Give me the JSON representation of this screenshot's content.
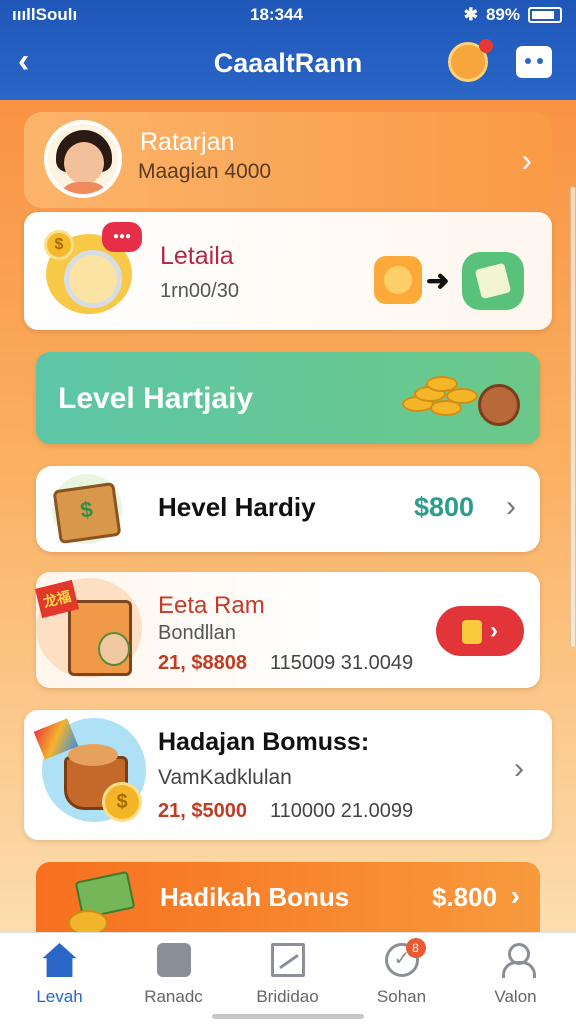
{
  "status": {
    "carrier": "ıııllSoulı",
    "time": "18:344",
    "battery": "89%"
  },
  "header": {
    "title": "CaaaltRann"
  },
  "profile": {
    "name": "Ratarjan",
    "subtitle": "Maagian 4000"
  },
  "card1": {
    "title": "Letaila",
    "subtitle": "1rn00/30"
  },
  "banner": {
    "label": "Level Hartjaiy"
  },
  "card2": {
    "title": "Hevel Hardiy",
    "amount": "$800"
  },
  "card3": {
    "tag": "龙福",
    "title": "Eeta Ram",
    "subtitle": "Bondllan",
    "meta_price": "21, $8808",
    "meta_numbers": "115009 31.0049"
  },
  "card4": {
    "title": "Hadajan Bomuss:",
    "subtitle": "VamKadklulan",
    "meta_price": "21, $5000",
    "meta_numbers": "110000 21.0099"
  },
  "bottom_banner": {
    "title": "Hadikah Bonus",
    "amount": "$.800"
  },
  "tabbar": {
    "items": [
      {
        "label": "Levah",
        "icon": "home-icon"
      },
      {
        "label": "Ranadc",
        "icon": "chat-icon"
      },
      {
        "label": "Brididao",
        "icon": "chart-icon"
      },
      {
        "label": "Sohan",
        "icon": "check-icon",
        "badge": "8"
      },
      {
        "label": "Valon",
        "icon": "person-icon"
      }
    ]
  },
  "colors": {
    "header_bg": "#2a66c6",
    "accent_teal": "#2b9c8d",
    "accent_red": "#e2353a",
    "active_tab": "#2a66c6"
  }
}
